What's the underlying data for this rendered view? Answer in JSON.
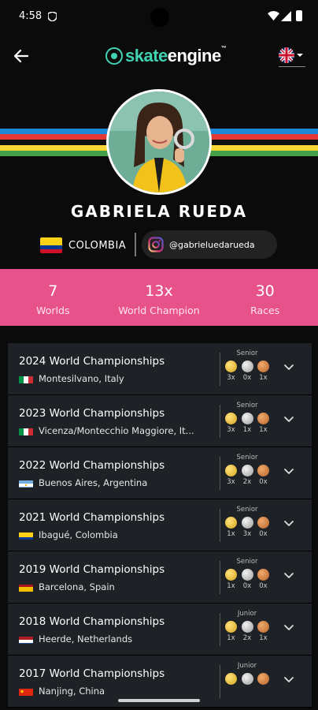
{
  "status": {
    "time": "4:58"
  },
  "header": {
    "logo_part1": "skate",
    "logo_part2": "engine",
    "logo_tm": "™"
  },
  "profile": {
    "name": "GABRIELA RUEDA",
    "country": "COLOMBIA",
    "instagram": "@gabrieluedarueda"
  },
  "stats": [
    {
      "value": "7",
      "label": "Worlds"
    },
    {
      "value": "13x",
      "label": "World Champion"
    },
    {
      "value": "30",
      "label": "Races"
    }
  ],
  "championships": [
    {
      "title": "2024 World Championships",
      "location": "Montesilvano, Italy",
      "flag": "it",
      "category": "Senior",
      "gold": "3x",
      "silver": "0x",
      "bronze": "1x"
    },
    {
      "title": "2023 World Championships",
      "location": "Vicenza/Montecchio Maggiore, It...",
      "flag": "it",
      "category": "Senior",
      "gold": "3x",
      "silver": "1x",
      "bronze": "1x"
    },
    {
      "title": "2022 World Championships",
      "location": "Buenos Aires, Argentina",
      "flag": "ar",
      "category": "Senior",
      "gold": "3x",
      "silver": "2x",
      "bronze": "0x"
    },
    {
      "title": "2021 World Championships",
      "location": "Ibagué, Colombia",
      "flag": "co",
      "category": "Senior",
      "gold": "1x",
      "silver": "3x",
      "bronze": "0x"
    },
    {
      "title": "2019 World Championships",
      "location": "Barcelona, Spain",
      "flag": "es",
      "category": "Senior",
      "gold": "1x",
      "silver": "0x",
      "bronze": "0x"
    },
    {
      "title": "2018 World Championships",
      "location": "Heerde, Netherlands",
      "flag": "nl",
      "category": "Junior",
      "gold": "1x",
      "silver": "2x",
      "bronze": "1x"
    },
    {
      "title": "2017 World Championships",
      "location": "Nanjing, China",
      "flag": "cn",
      "category": "Junior",
      "gold": "",
      "silver": "",
      "bronze": ""
    }
  ],
  "colors": {
    "accent": "#3fd3b4",
    "stats_bg": "#e8528b",
    "row_bg": "#1e2226",
    "stripes": [
      "#1e88d8",
      "#e53935",
      "#111111",
      "#fdd835",
      "#43a047"
    ]
  }
}
